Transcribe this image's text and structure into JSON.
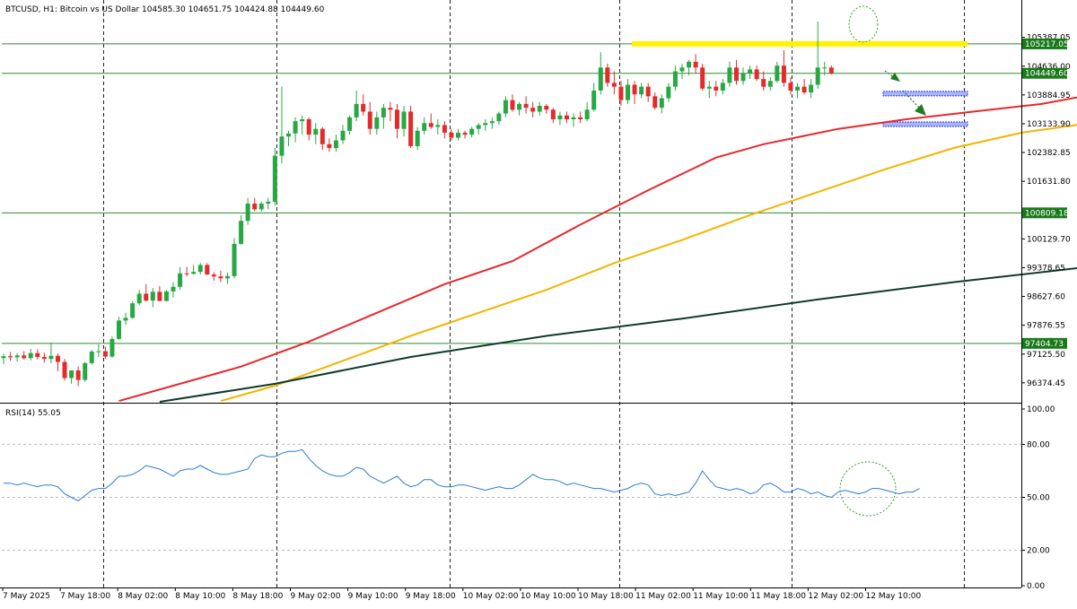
{
  "chart_data": {
    "type": "candlestick",
    "symbol_header": "BTCUSD, H1:  Bitcoin vs US Dollar  104585.30 104651.75 104424.88 104449.60",
    "price_axis": {
      "ticks": [
        "105387.05",
        "104636.00",
        "103884.95",
        "103133.90",
        "102382.85",
        "101631.80",
        "100129.70",
        "99378.65",
        "98627.60",
        "97876.55",
        "97125.50",
        "96374.45"
      ],
      "range": [
        95880,
        105800
      ]
    },
    "price_levels": [
      {
        "label": "105217.05",
        "value": 105217.05,
        "bg": "#1a7a1a"
      },
      {
        "label": "104449.60",
        "value": 104449.6,
        "bg": "#1a7a1a"
      },
      {
        "label": "100809.18",
        "value": 100809.18,
        "bg": "#1a7a1a"
      },
      {
        "label": "97404.73",
        "value": 97404.73,
        "bg": "#1a7a1a"
      }
    ],
    "time_axis": [
      "7 May 2025",
      "7 May 18:00",
      "8 May 02:00",
      "8 May 10:00",
      "8 May 18:00",
      "9 May 02:00",
      "9 May 10:00",
      "9 May 18:00",
      "10 May 02:00",
      "10 May 10:00",
      "10 May 18:00",
      "11 May 02:00",
      "11 May 10:00",
      "11 May 18:00",
      "12 May 02:00",
      "12 May 10:00"
    ],
    "candles": [
      [
        97020,
        97140,
        96860,
        97070
      ],
      [
        97070,
        97180,
        96950,
        97040
      ],
      [
        97040,
        97150,
        96930,
        97090
      ],
      [
        97090,
        97200,
        96980,
        97020
      ],
      [
        97020,
        97260,
        96960,
        97150
      ],
      [
        97150,
        97250,
        96990,
        97050
      ],
      [
        97050,
        97160,
        96900,
        97000
      ],
      [
        97000,
        97420,
        96880,
        97080
      ],
      [
        97080,
        97140,
        96680,
        96920
      ],
      [
        96920,
        97000,
        96430,
        96500
      ],
      [
        96500,
        96700,
        96350,
        96700
      ],
      [
        96700,
        96800,
        96290,
        96450
      ],
      [
        96450,
        96920,
        96400,
        96890
      ],
      [
        96890,
        97240,
        96850,
        97190
      ],
      [
        97190,
        97380,
        97050,
        97200
      ],
      [
        97200,
        97320,
        97000,
        97060
      ],
      [
        97060,
        97580,
        97030,
        97520
      ],
      [
        97520,
        98100,
        97500,
        98000
      ],
      [
        98000,
        98200,
        97890,
        98070
      ],
      [
        98070,
        98500,
        98050,
        98450
      ],
      [
        98450,
        98800,
        98400,
        98700
      ],
      [
        98700,
        98950,
        98500,
        98520
      ],
      [
        98520,
        98850,
        98350,
        98750
      ],
      [
        98750,
        98900,
        98500,
        98510
      ],
      [
        98510,
        98800,
        98500,
        98760
      ],
      [
        98760,
        99000,
        98600,
        98880
      ],
      [
        98880,
        99400,
        98800,
        99230
      ],
      [
        99230,
        99400,
        99150,
        99220
      ],
      [
        99220,
        99450,
        99200,
        99270
      ],
      [
        99270,
        99500,
        99200,
        99450
      ],
      [
        99450,
        99500,
        99190,
        99200
      ],
      [
        99200,
        99260,
        99040,
        99150
      ],
      [
        99150,
        99300,
        99000,
        99100
      ],
      [
        99100,
        99250,
        98950,
        99160
      ],
      [
        99160,
        100150,
        99100,
        100000
      ],
      [
        100000,
        100750,
        99980,
        100600
      ],
      [
        100600,
        101200,
        100500,
        101050
      ],
      [
        101050,
        101200,
        100850,
        100900
      ],
      [
        100900,
        101100,
        100850,
        101050
      ],
      [
        101050,
        101200,
        100900,
        101100
      ],
      [
        101100,
        102500,
        101000,
        102300
      ],
      [
        102300,
        104100,
        102100,
        102800
      ],
      [
        102800,
        102950,
        102550,
        102880
      ],
      [
        102880,
        103300,
        102650,
        103200
      ],
      [
        103200,
        103350,
        102850,
        103250
      ],
      [
        103250,
        103300,
        102700,
        102850
      ],
      [
        102850,
        103150,
        102600,
        103000
      ],
      [
        103000,
        103050,
        102450,
        102600
      ],
      [
        102600,
        102750,
        102400,
        102500
      ],
      [
        102500,
        102850,
        102400,
        102700
      ],
      [
        102700,
        103100,
        102600,
        102950
      ],
      [
        102950,
        103350,
        102850,
        103300
      ],
      [
        103300,
        104000,
        103200,
        103650
      ],
      [
        103650,
        103900,
        103350,
        103450
      ],
      [
        103450,
        103700,
        102850,
        103000
      ],
      [
        103000,
        103450,
        102850,
        103300
      ],
      [
        103300,
        103650,
        103000,
        103550
      ],
      [
        103550,
        103700,
        103200,
        103500
      ],
      [
        103500,
        103650,
        102750,
        103000
      ],
      [
        103000,
        103600,
        102800,
        103450
      ],
      [
        103450,
        103600,
        102500,
        102550
      ],
      [
        102550,
        103050,
        102450,
        102950
      ],
      [
        102950,
        103300,
        102850,
        103150
      ],
      [
        103150,
        103400,
        103000,
        103050
      ],
      [
        103050,
        103250,
        102850,
        103100
      ],
      [
        103100,
        103200,
        102750,
        102900
      ],
      [
        102900,
        103000,
        102700,
        102770
      ],
      [
        102770,
        103000,
        102700,
        102900
      ],
      [
        102900,
        102950,
        102750,
        102850
      ],
      [
        102850,
        103050,
        102780,
        103000
      ],
      [
        103000,
        103150,
        102850,
        103100
      ],
      [
        103100,
        103250,
        102950,
        103150
      ],
      [
        103150,
        103300,
        103000,
        103200
      ],
      [
        103200,
        103450,
        103100,
        103400
      ],
      [
        103400,
        103850,
        103300,
        103750
      ],
      [
        103750,
        103900,
        103450,
        103500
      ],
      [
        103500,
        103700,
        103350,
        103650
      ],
      [
        103650,
        103850,
        103400,
        103550
      ],
      [
        103550,
        103700,
        103300,
        103450
      ],
      [
        103450,
        103700,
        103350,
        103600
      ],
      [
        103600,
        103650,
        103400,
        103500
      ],
      [
        103500,
        103550,
        103150,
        103250
      ],
      [
        103250,
        103450,
        103100,
        103350
      ],
      [
        103350,
        103450,
        103150,
        103250
      ],
      [
        103250,
        103400,
        103050,
        103300
      ],
      [
        103300,
        103450,
        103150,
        103250
      ],
      [
        103250,
        103700,
        103200,
        103500
      ],
      [
        103500,
        104200,
        103450,
        104000
      ],
      [
        104000,
        105000,
        103900,
        104600
      ],
      [
        104600,
        104700,
        104100,
        104200
      ],
      [
        104200,
        104500,
        103900,
        104100
      ],
      [
        104100,
        104250,
        103600,
        103750
      ],
      [
        103750,
        104300,
        103650,
        104150
      ],
      [
        104150,
        104250,
        103650,
        103900
      ],
      [
        103900,
        104200,
        103800,
        104100
      ],
      [
        104100,
        104200,
        103700,
        103850
      ],
      [
        103850,
        103950,
        103500,
        103550
      ],
      [
        103550,
        103900,
        103400,
        103800
      ],
      [
        103800,
        104200,
        103700,
        104100
      ],
      [
        104100,
        104650,
        104000,
        104500
      ],
      [
        104500,
        104700,
        104300,
        104600
      ],
      [
        104600,
        104800,
        104400,
        104750
      ],
      [
        104750,
        104950,
        104450,
        104600
      ],
      [
        104600,
        104700,
        104000,
        104050
      ],
      [
        104050,
        104250,
        103800,
        104100
      ],
      [
        104100,
        104250,
        103850,
        104000
      ],
      [
        104000,
        104300,
        103900,
        104200
      ],
      [
        104200,
        104750,
        104100,
        104600
      ],
      [
        104600,
        104800,
        104150,
        104250
      ],
      [
        104250,
        104600,
        104150,
        104450
      ],
      [
        104450,
        104650,
        104300,
        104550
      ],
      [
        104550,
        104650,
        104250,
        104300
      ],
      [
        104300,
        104500,
        104000,
        104100
      ],
      [
        104100,
        104350,
        104000,
        104250
      ],
      [
        104250,
        104750,
        104200,
        104650
      ],
      [
        104650,
        105050,
        104100,
        104200
      ],
      [
        104200,
        104350,
        103900,
        104000
      ],
      [
        104000,
        104200,
        103800,
        104100
      ],
      [
        104100,
        104300,
        103900,
        103950
      ],
      [
        103950,
        104300,
        103800,
        104150
      ],
      [
        104150,
        105800,
        104050,
        104600
      ],
      [
        104600,
        104750,
        104400,
        104600
      ],
      [
        104600,
        104650,
        104420,
        104450
      ]
    ],
    "ma_series": [
      {
        "color": "#e8282b",
        "points": [
          [
            17,
            95900
          ],
          [
            25,
            96300
          ],
          [
            35,
            96800
          ],
          [
            45,
            97450
          ],
          [
            55,
            98200
          ],
          [
            65,
            98950
          ],
          [
            75,
            99550
          ],
          [
            85,
            100500
          ],
          [
            95,
            101400
          ],
          [
            105,
            102250
          ],
          [
            112,
            102600
          ],
          [
            123,
            103000
          ],
          [
            133,
            103250
          ],
          [
            143,
            103450
          ],
          [
            153,
            103650
          ],
          [
            160,
            103880
          ]
        ]
      },
      {
        "color": "#f4b400",
        "points": [
          [
            32,
            95900
          ],
          [
            40,
            96300
          ],
          [
            50,
            96950
          ],
          [
            60,
            97600
          ],
          [
            70,
            98200
          ],
          [
            80,
            98800
          ],
          [
            90,
            99500
          ],
          [
            100,
            100100
          ],
          [
            110,
            100750
          ],
          [
            120,
            101350
          ],
          [
            130,
            101950
          ],
          [
            140,
            102500
          ],
          [
            150,
            102900
          ],
          [
            160,
            103150
          ]
        ]
      },
      {
        "color": "#0d3b2b",
        "points": [
          [
            23,
            95880
          ],
          [
            40,
            96350
          ],
          [
            60,
            97050
          ],
          [
            80,
            97600
          ],
          [
            100,
            98050
          ],
          [
            120,
            98550
          ],
          [
            140,
            99000
          ],
          [
            160,
            99400
          ]
        ]
      }
    ],
    "rsi": {
      "label": "RSI(14) 55.05",
      "ticks": [
        "100.00",
        "80.00",
        "50.00",
        "20.00",
        "0.00"
      ],
      "levels": [
        80,
        50,
        20
      ],
      "values": [
        58,
        58,
        57,
        58,
        57,
        56,
        57,
        57,
        56,
        52,
        50,
        48,
        51,
        54,
        55,
        55,
        58,
        62,
        62,
        63,
        65,
        68,
        67,
        66,
        64,
        62,
        65,
        66,
        66,
        68,
        66,
        64,
        63,
        63,
        64,
        65,
        66,
        72,
        74,
        73,
        73,
        75,
        76,
        76,
        77,
        72,
        68,
        65,
        63,
        62,
        62,
        64,
        67,
        66,
        62,
        60,
        58,
        60,
        62,
        58,
        56,
        57,
        60,
        60,
        57,
        56,
        56,
        57,
        57,
        56,
        55,
        54,
        55,
        56,
        55,
        55,
        57,
        60,
        63,
        61,
        60,
        60,
        59,
        57,
        58,
        57,
        56,
        55,
        55,
        54,
        53,
        54,
        55,
        57,
        58,
        57,
        52,
        51,
        52,
        51,
        52,
        53,
        58,
        65,
        60,
        56,
        55,
        54,
        55,
        54,
        52,
        53,
        57,
        58,
        56,
        53,
        53,
        55,
        54,
        52,
        53,
        51,
        50,
        53,
        54,
        53,
        52,
        53,
        55,
        55,
        54,
        53,
        52,
        53,
        53,
        55
      ]
    },
    "annotations": {
      "resistance_band_color": "#fff200",
      "target_boxes_color": "#2b3fd6",
      "circle_color": "#2ca02c",
      "arrow_color": "#1f7a1f"
    }
  }
}
